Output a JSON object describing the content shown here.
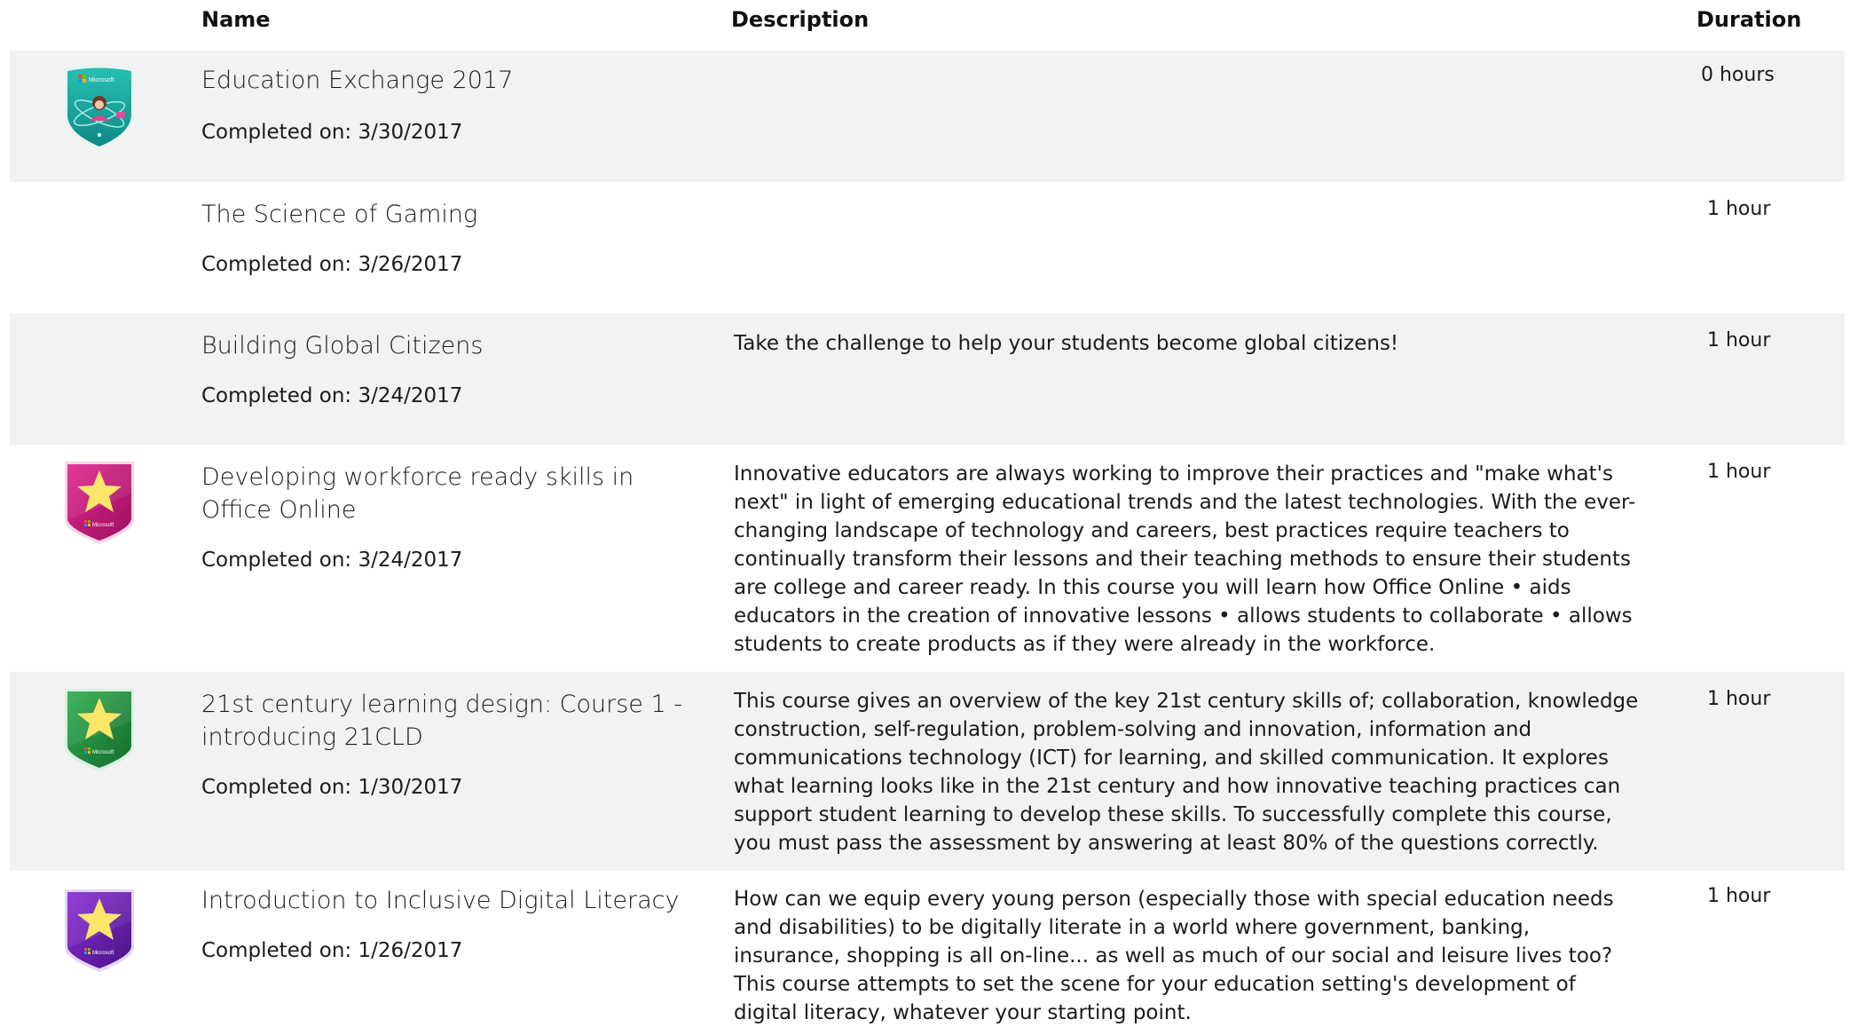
{
  "headers": {
    "name": "Name",
    "description": "Description",
    "duration": "Duration"
  },
  "courses": [
    {
      "title": "Education Exchange 2017",
      "completed": "Completed on: 3/30/2017",
      "description": "",
      "duration": "0 hours",
      "badge": "education-exchange-badge-teal",
      "badge_brand": "Microsoft"
    },
    {
      "title": "The Science of Gaming",
      "completed": "Completed on: 3/26/2017",
      "description": "",
      "duration": "1 hour",
      "badge": ""
    },
    {
      "title": "Building Global Citizens",
      "completed": "Completed on: 3/24/2017",
      "description": "Take the challenge to help your students become global citizens!",
      "duration": "1 hour",
      "badge": ""
    },
    {
      "title": "Developing workforce ready skills in Office Online",
      "completed": "Completed on: 3/24/2017",
      "description": "Innovative educators are always working to improve their practices and \"make what's next\" in light of emerging educational trends and the latest technologies. With the ever-changing landscape of technology and careers, best practices require teachers to continually transform their lessons and their teaching methods to ensure their students are college and career ready. In this course you will learn how Office Online • aids educators in the creation of innovative lessons • allows students to collaborate • allows students to create products as if they were already in the workforce.",
      "duration": "1 hour",
      "badge": "star-badge-magenta",
      "badge_brand": "Microsoft"
    },
    {
      "title": "21st century learning design: Course 1 - introducing 21CLD",
      "completed": "Completed on: 1/30/2017",
      "description": "This course gives an overview of the key 21st century skills of; collaboration, knowledge construction, self-regulation, problem-solving and innovation, information and communications technology (ICT) for learning, and skilled communication. It explores what learning looks like in the 21st century and how innovative teaching practices can support student learning to develop these skills. To successfully complete this course, you must pass the assessment by answering at least 80% of the questions correctly.",
      "duration": "1 hour",
      "badge": "star-badge-green",
      "badge_brand": "Microsoft"
    },
    {
      "title": "Introduction to Inclusive Digital Literacy",
      "completed": "Completed on: 1/26/2017",
      "description": "How can we equip every young person (especially those with special education needs and disabilities) to be digitally literate in a world where government, banking, insurance, shopping is all on-line... as well as much of our social and leisure lives too? This course attempts to set the scene for your education setting's development of digital literacy, whatever your starting point.",
      "duration": "1 hour",
      "badge": "star-badge-purple",
      "badge_brand": "Microsoft"
    }
  ],
  "colors": {
    "row_shade": "#f2f2f2",
    "teal_badge": "#1aa59b",
    "magenta_badge": "#c2187a",
    "green_badge": "#1f8a3c",
    "purple_badge": "#6a1fb0",
    "star": "#fbe66a"
  }
}
